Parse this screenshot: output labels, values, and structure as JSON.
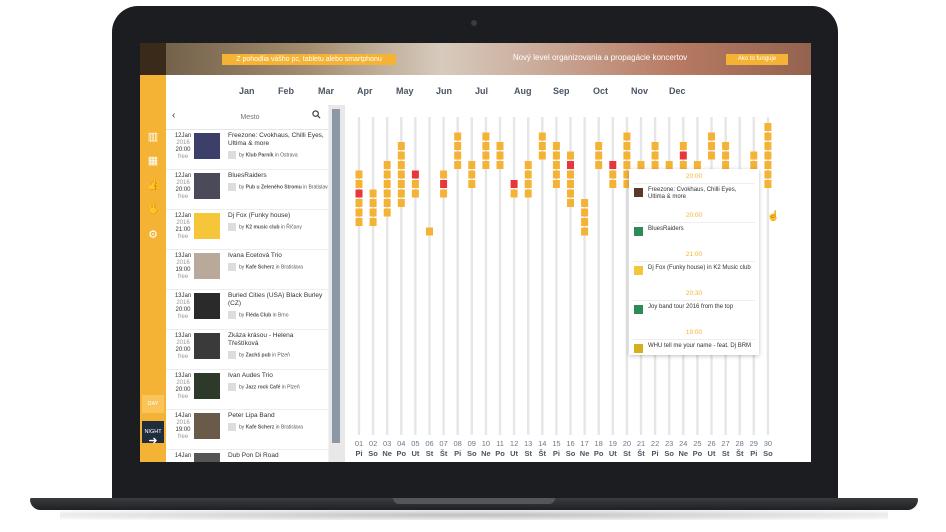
{
  "banner": {
    "left_text": "Z pohodlia vášho pc, tabletu alebo smartphonu",
    "mid_text": "Nový level organizovania a propagácie koncertov",
    "button": "Ako to funguje"
  },
  "rail": {
    "icons": [
      "chart-icon",
      "calendar-icon",
      "thumbs-up-icon",
      "hand-icon",
      "gear-icon"
    ],
    "day_label": "DAY",
    "night_label": "NIGHT",
    "logout_icon": "logout-icon"
  },
  "months": [
    "Jan",
    "Feb",
    "Mar",
    "Apr",
    "May",
    "Jun",
    "Jul",
    "Aug",
    "Sep",
    "Oct",
    "Nov",
    "Dec"
  ],
  "search": {
    "placeholder": "Mesto"
  },
  "events": [
    {
      "day": "12Jan",
      "year": "2016",
      "time": "20:00",
      "price": "free",
      "title": "Freezone: Cvokhaus, Chilli Eyes, Ultima & more",
      "by": "by",
      "venue": "Klub Parník",
      "in": "in",
      "city": "Ostrava"
    },
    {
      "day": "12Jan",
      "year": "2016",
      "time": "20:00",
      "price": "free",
      "title": "BluesRaiders",
      "by": "by",
      "venue": "Pub u Zeleného Stromu",
      "in": "in",
      "city": "Bratislava"
    },
    {
      "day": "12Jan",
      "year": "2016",
      "time": "21:00",
      "price": "free",
      "title": "Dj Fox (Funky house)",
      "by": "by",
      "venue": "K2 music club",
      "in": "in",
      "city": "Říčany"
    },
    {
      "day": "13Jan",
      "year": "2016",
      "time": "19:00",
      "price": "free",
      "title": "Ivana Ecetová Trio",
      "by": "by",
      "venue": "Kafe Scherz",
      "in": "in",
      "city": "Bratislava"
    },
    {
      "day": "13Jan",
      "year": "2016",
      "time": "20:00",
      "price": "free",
      "title": "Buried Cities (USA) Black Burley (CZ)",
      "by": "by",
      "venue": "Fléda Club",
      "in": "in",
      "city": "Brno"
    },
    {
      "day": "13Jan",
      "year": "2016",
      "time": "20:00",
      "price": "free",
      "title": "Zkáza krásou - Helena Třeštíková",
      "by": "by",
      "venue": "Zachš pub",
      "in": "in",
      "city": "Plzeň"
    },
    {
      "day": "13Jan",
      "year": "2016",
      "time": "20:00",
      "price": "free",
      "title": "Ivan Audes Trio",
      "by": "by",
      "venue": "Jazz rock Café",
      "in": "in",
      "city": "Plzeň"
    },
    {
      "day": "14Jan",
      "year": "2016",
      "time": "19:00",
      "price": "free",
      "title": "Peter Lipa Band",
      "by": "by",
      "venue": "Kafe Scherz",
      "in": "in",
      "city": "Bratislava"
    },
    {
      "day": "14Jan",
      "year": "",
      "time": "",
      "price": "",
      "title": "Dub Pon Di Road",
      "by": "",
      "venue": "",
      "in": "",
      "city": ""
    }
  ],
  "days": [
    "01",
    "02",
    "03",
    "04",
    "05",
    "06",
    "07",
    "08",
    "09",
    "10",
    "11",
    "12",
    "13",
    "14",
    "15",
    "16",
    "17",
    "18",
    "19",
    "20",
    "21",
    "22",
    "23",
    "24",
    "25",
    "26",
    "27",
    "28",
    "29",
    "30"
  ],
  "weekdays": [
    "Pi",
    "So",
    "Ne",
    "Po",
    "Ut",
    "St",
    "Št",
    "Pi",
    "So",
    "Ne",
    "Po",
    "Ut",
    "St",
    "Št",
    "Pi",
    "So",
    "Ne",
    "Po",
    "Ut",
    "St",
    "Št",
    "Pi",
    "So",
    "Ne",
    "Po",
    "Ut",
    "St",
    "Št",
    "Pi",
    "So"
  ],
  "tooltip": [
    {
      "time": "20:00",
      "title": "Freezone: Cvokhaus, Chilli Eyes, Ultima & more"
    },
    {
      "time": "20:00",
      "title": "BluesRaiders"
    },
    {
      "time": "21:00",
      "title": "Dj Fox (Funky house) in K2 Music club"
    },
    {
      "time": "20:30",
      "title": "Joy band tour 2016 from the top"
    },
    {
      "time": "19:00",
      "title": "WHU tell me your name - feat. Dj BRM"
    }
  ],
  "colors": {
    "accent": "#f5b335",
    "alert": "#e8363a",
    "navy": "#1f2d3d"
  }
}
